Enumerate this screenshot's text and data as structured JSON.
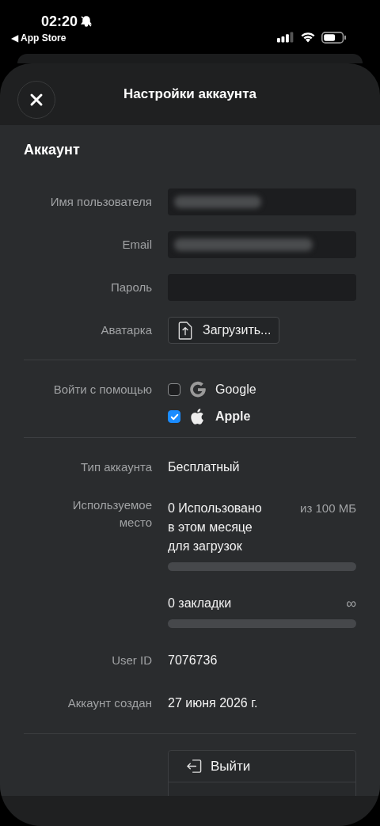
{
  "status_bar": {
    "time": "02:20",
    "back_link": "◀ App Store"
  },
  "header": {
    "title": "Настройки аккаунта"
  },
  "section": {
    "title": "Аккаунт"
  },
  "fields": [
    {
      "label": "Имя пользователя",
      "kind": "blurred"
    },
    {
      "label": "Email",
      "kind": "blurred"
    },
    {
      "label": "Пароль",
      "kind": "empty"
    }
  ],
  "avatar": {
    "label": "Аватарка",
    "button": "Загрузить..."
  },
  "login": {
    "label": "Войти с помощью",
    "providers": [
      {
        "name": "Google",
        "kind": "google",
        "checked": false
      },
      {
        "name": "Apple",
        "kind": "apple",
        "checked": true
      }
    ]
  },
  "account_type": {
    "label": "Тип аккаунта",
    "value": "Бесплатный"
  },
  "usage": {
    "label": "Используемое\nместо",
    "meters": [
      {
        "text": "0 Использовано\nв этом месяце\nдля загрузок",
        "limit": "из 100 МБ",
        "level": 0
      },
      {
        "text": "0 закладки",
        "limit": "∞",
        "level": 0
      }
    ]
  },
  "user_id": {
    "label": "User ID",
    "value": "7076736"
  },
  "created": {
    "label": "Аккаунт создан",
    "value": "27 июня 2026 г."
  },
  "logout": {
    "button": "Выйти"
  }
}
